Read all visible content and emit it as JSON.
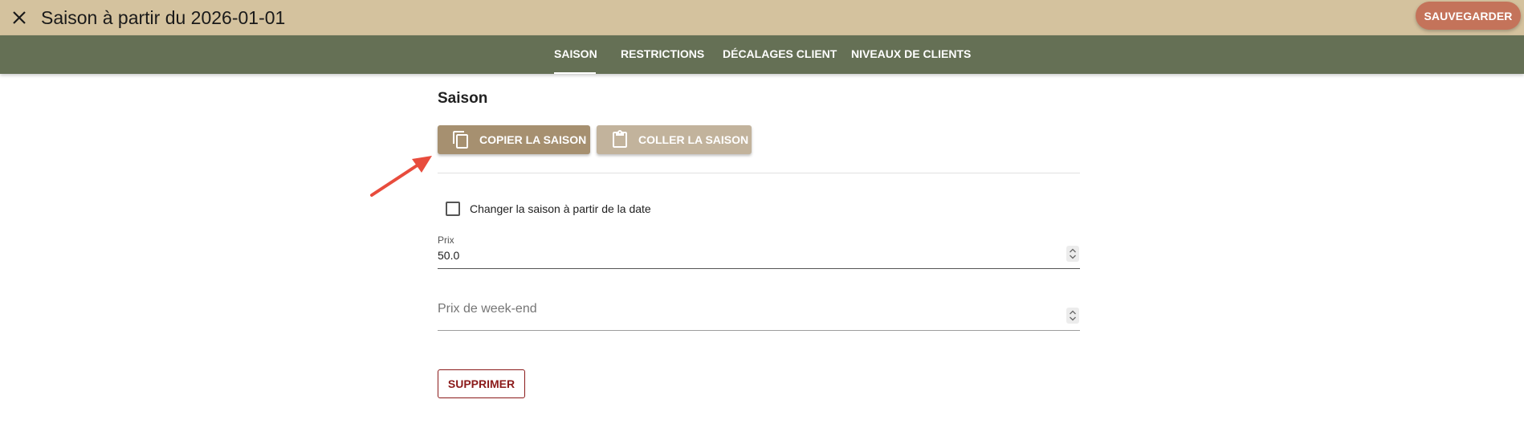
{
  "header": {
    "title": "Saison à partir du 2026-01-01",
    "close_icon": "close-icon",
    "save_label": "SAUVEGARDER"
  },
  "tabs": [
    {
      "label": "SAISON",
      "active": true
    },
    {
      "label": "RESTRICTIONS",
      "active": false
    },
    {
      "label": "DÉCALAGES CLIENT",
      "active": false
    },
    {
      "label": "NIVEAUX DE CLIENTS",
      "active": false
    }
  ],
  "section": {
    "title": "Saison",
    "copy_label": "COPIER LA SAISON",
    "copy_icon": "copy-icon",
    "paste_label": "COLLER LA SAISON",
    "paste_icon": "clipboard-icon"
  },
  "form": {
    "change_date_label": "Changer la saison à partir de la date",
    "change_date_checked": false,
    "price_label": "Prix",
    "price_value": "50.0",
    "weekend_price_placeholder": "Prix de week-end",
    "weekend_price_value": ""
  },
  "actions": {
    "delete_label": "SUPPRIMER"
  },
  "colors": {
    "header_bg": "#d4c29e",
    "tabbar_bg": "#657055",
    "save_button": "#c4735a",
    "copy_button": "#a69070",
    "paste_button": "#c2b39c",
    "delete_text": "#8b1a1a",
    "annotation_arrow": "#e84c3d"
  }
}
